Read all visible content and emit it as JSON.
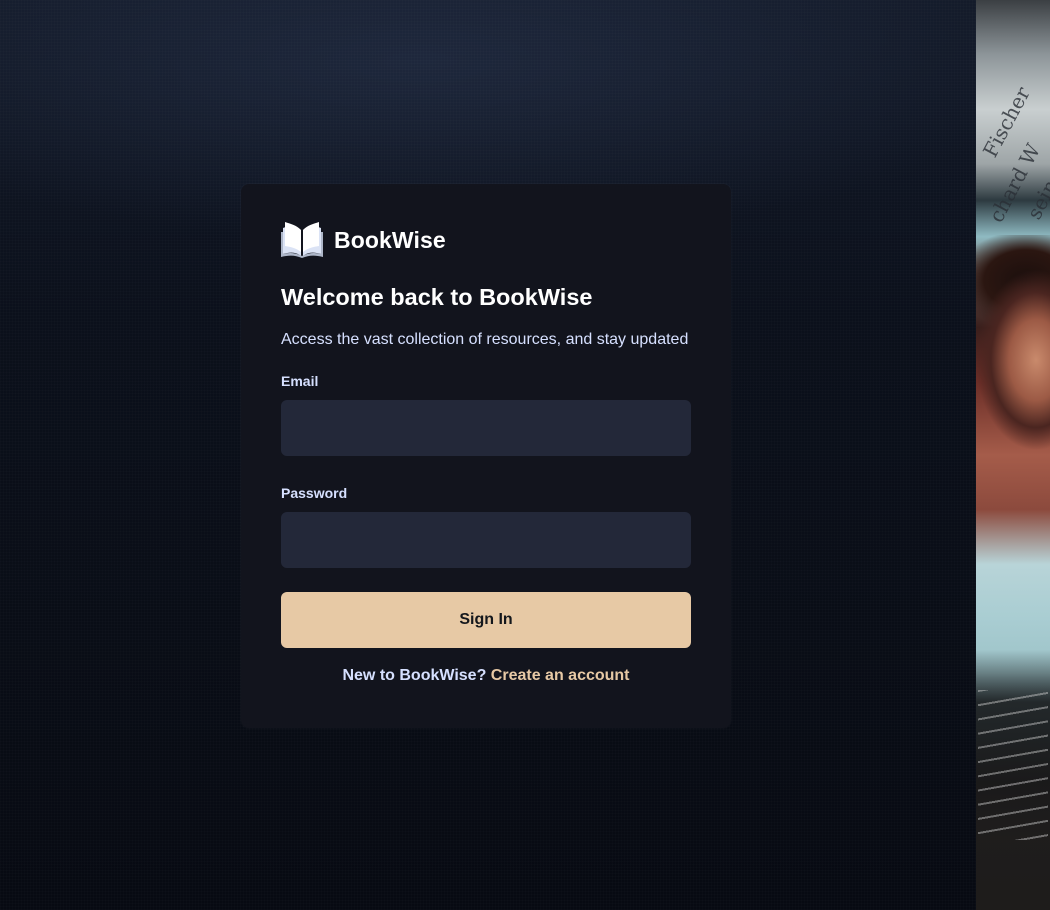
{
  "brand": {
    "name": "BookWise",
    "logo_icon": "open-book-icon"
  },
  "heading": {
    "title": "Welcome back to BookWise",
    "subtitle": "Access the vast collection of resources, and stay updated"
  },
  "form": {
    "email_label": "Email",
    "email_value": "",
    "password_label": "Password",
    "password_value": "",
    "submit_label": "Sign In"
  },
  "footer": {
    "prompt": "New to BookWise?",
    "link_label": "Create an account"
  },
  "colors": {
    "background": "#0a0e17",
    "card": "#12141d",
    "input": "#232839",
    "accent": "#e7c9a5",
    "text_light": "#d6e0ff",
    "text_white": "#ffffff"
  },
  "side_image": {
    "visible_text": [
      "Fischer",
      "chard W",
      "sein"
    ]
  }
}
